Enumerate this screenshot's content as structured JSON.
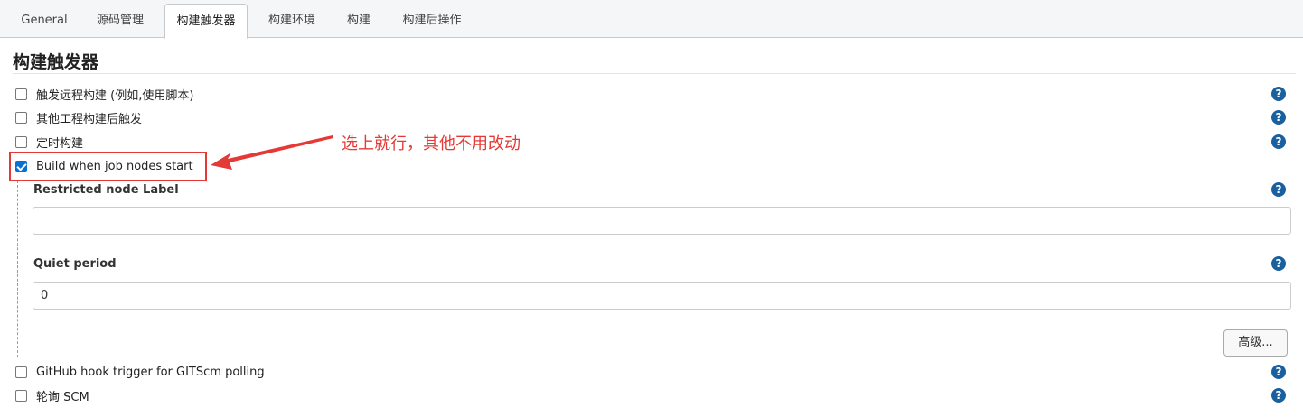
{
  "tabs": [
    {
      "label": "General"
    },
    {
      "label": "源码管理"
    },
    {
      "label": "构建触发器",
      "active": true
    },
    {
      "label": "构建环境"
    },
    {
      "label": "构建"
    },
    {
      "label": "构建后操作"
    }
  ],
  "section": {
    "title": "构建触发器"
  },
  "triggers": [
    {
      "label": "触发远程构建 (例如,使用脚本)",
      "checked": false
    },
    {
      "label": "其他工程构建后触发",
      "checked": false
    },
    {
      "label": "定时构建",
      "checked": false
    },
    {
      "label": "Build when job nodes start",
      "checked": true
    },
    {
      "label": "GitHub hook trigger for GITScm polling",
      "checked": false
    },
    {
      "label": "轮询 SCM",
      "checked": false
    }
  ],
  "fields": {
    "restricted_label": "Restricted node Label",
    "restricted_value": "",
    "quiet_label": "Quiet period",
    "quiet_value": "0"
  },
  "advanced_button": "高级...",
  "annotation": "选上就行，其他不用改动",
  "help_glyph": "?",
  "colors": {
    "accent": "#0a70d1",
    "annotation": "#e53935",
    "help": "#1a5f9e"
  }
}
